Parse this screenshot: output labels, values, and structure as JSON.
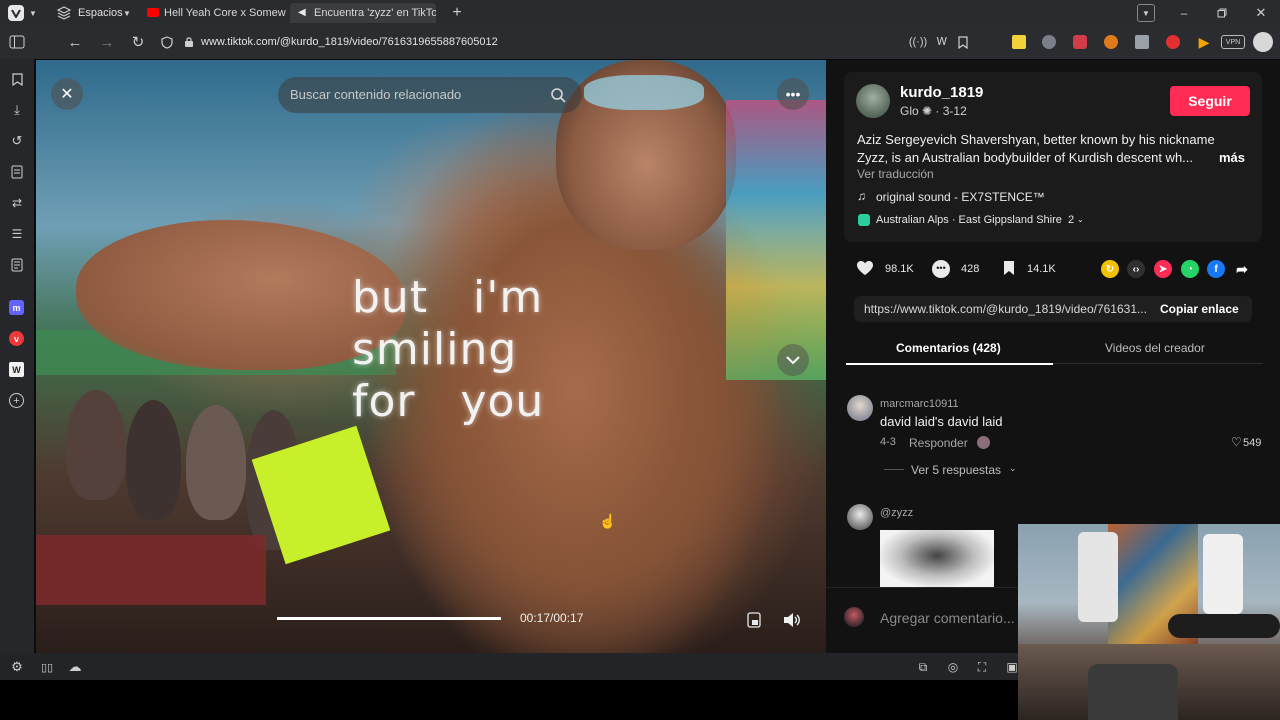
{
  "browser": {
    "workspaces_label": "Espacios",
    "tabs": [
      {
        "title": "Hell Yeah Core x Somewhe"
      },
      {
        "title": "Encuentra 'zyzz' en TikTok |"
      }
    ],
    "url": "www.tiktok.com/@kurdo_1819/video/7616319655887605012"
  },
  "video": {
    "search_placeholder": "Buscar contenido relacionado",
    "overlay_text": "but   i'm\nsmiling\nfor   you",
    "time": "00:17/00:17",
    "progress_fraction": 1.0
  },
  "post": {
    "username": "kurdo_1819",
    "subtitle": "Glo ✺ · 3-12",
    "follow_label": "Seguir",
    "description_line1": "Aziz Sergeyevich Shavershyan, better known by his nickname",
    "description_line2": "Zyzz, is an Australian bodybuilder of Kurdish descent wh...",
    "more_label": "más",
    "translate_label": "Ver traducción",
    "sound": "original sound - EX7STENCE™",
    "location": "Australian Alps · East Gippsland Shire",
    "location_count": "2",
    "likes": "98.1K",
    "comments": "428",
    "saves": "14.1K",
    "link": "https://www.tiktok.com/@kurdo_1819/video/761631...",
    "copy_label": "Copiar enlace"
  },
  "tabs": {
    "comments_label": "Comentarios (428)",
    "creator_videos_label": "Videos del creador"
  },
  "comments": [
    {
      "user": "marcmarc10911",
      "text": "david laid's david laid",
      "date": "4-3",
      "reply_label": "Responder",
      "likes": "549",
      "replies_label": "Ver 5 respuestas"
    },
    {
      "user": "@zyzz"
    }
  ],
  "add_comment_placeholder": "Agregar comentario...",
  "colors": {
    "accent": "#fe2c55",
    "background": "#121212"
  }
}
